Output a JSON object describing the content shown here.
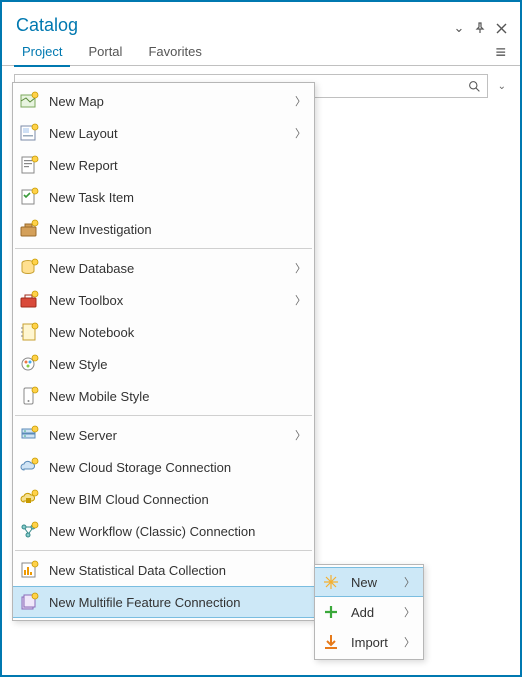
{
  "title": "Catalog",
  "tabs": {
    "project": "Project",
    "portal": "Portal",
    "favorites": "Favorites",
    "active": "project"
  },
  "menu": {
    "items": [
      {
        "label": "New Map",
        "icon": "map",
        "hasSub": true
      },
      {
        "label": "New Layout",
        "icon": "layout",
        "hasSub": true
      },
      {
        "label": "New Report",
        "icon": "report",
        "hasSub": false
      },
      {
        "label": "New Task Item",
        "icon": "task",
        "hasSub": false
      },
      {
        "label": "New Investigation",
        "icon": "investigation",
        "hasSub": false
      }
    ],
    "items2": [
      {
        "label": "New Database",
        "icon": "database",
        "hasSub": true
      },
      {
        "label": "New Toolbox",
        "icon": "toolbox",
        "hasSub": true
      },
      {
        "label": "New Notebook",
        "icon": "notebook",
        "hasSub": false
      },
      {
        "label": "New Style",
        "icon": "style",
        "hasSub": false
      },
      {
        "label": "New Mobile Style",
        "icon": "mobilestyle",
        "hasSub": false
      }
    ],
    "items3": [
      {
        "label": "New Server",
        "icon": "server",
        "hasSub": true
      },
      {
        "label": "New Cloud Storage Connection",
        "icon": "cloud",
        "hasSub": false
      },
      {
        "label": "New BIM Cloud Connection",
        "icon": "bim",
        "hasSub": false
      },
      {
        "label": "New Workflow (Classic) Connection",
        "icon": "workflow",
        "hasSub": false
      }
    ],
    "items4": [
      {
        "label": "New Statistical Data Collection",
        "icon": "stats",
        "hasSub": false
      },
      {
        "label": "New Multifile Feature Connection",
        "icon": "multifile",
        "hasSub": false,
        "highlight": true
      }
    ]
  },
  "submenu": {
    "items": [
      {
        "label": "New",
        "icon": "new",
        "hasSub": true,
        "highlight": true
      },
      {
        "label": "Add",
        "icon": "add",
        "hasSub": true
      },
      {
        "label": "Import",
        "icon": "import",
        "hasSub": true
      }
    ]
  }
}
